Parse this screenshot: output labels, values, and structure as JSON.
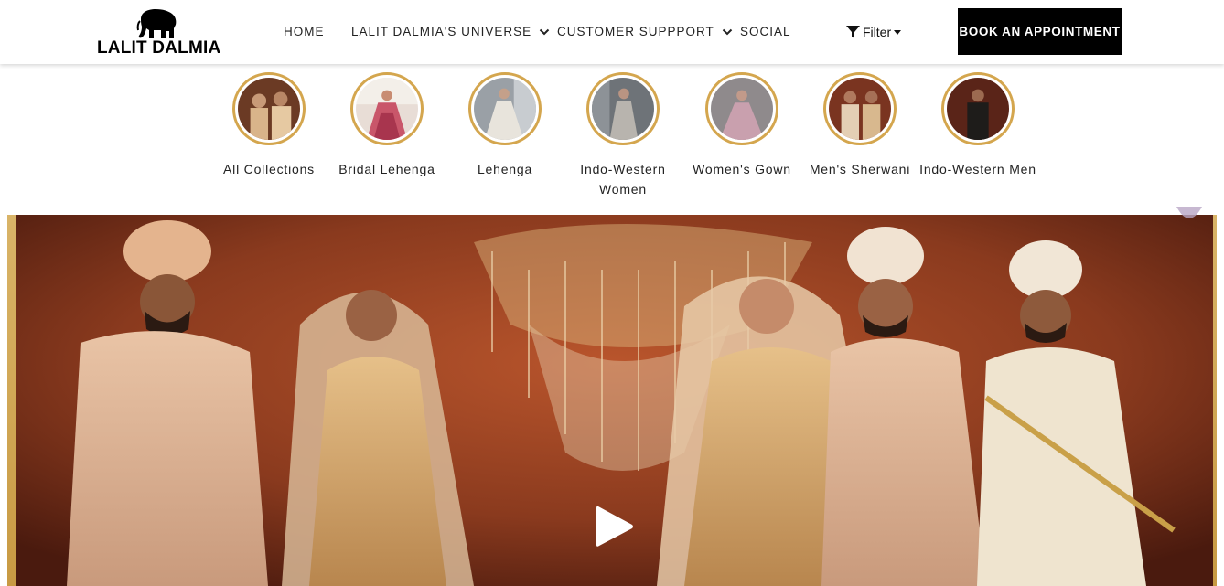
{
  "brand": {
    "name": "LALIT DALMIA"
  },
  "nav": {
    "items": [
      {
        "label": "HOME",
        "dropdown": false
      },
      {
        "label": "LALIT DALMIA'S UNIVERSE",
        "dropdown": true
      },
      {
        "label": "CUSTOMER SUPPPORT",
        "dropdown": true
      },
      {
        "label": "SOCIAL",
        "dropdown": false
      }
    ],
    "filter_label": "Filter",
    "book_label": "BOOK AN APPOINTMENT"
  },
  "categories": [
    {
      "label": "All Collections"
    },
    {
      "label": "Bridal Lehenga"
    },
    {
      "label": "Lehenga"
    },
    {
      "label": "Indo-Western Women"
    },
    {
      "label": "Women's Gown"
    },
    {
      "label": "Men's Sherwani"
    },
    {
      "label": "Indo-Western Men"
    }
  ],
  "hero": {
    "media": "video",
    "icons": [
      "play-icon"
    ]
  },
  "colors": {
    "accent_gold": "#d4a64e",
    "button_bg": "#000000",
    "hero_bg": "#8a3a1e"
  }
}
